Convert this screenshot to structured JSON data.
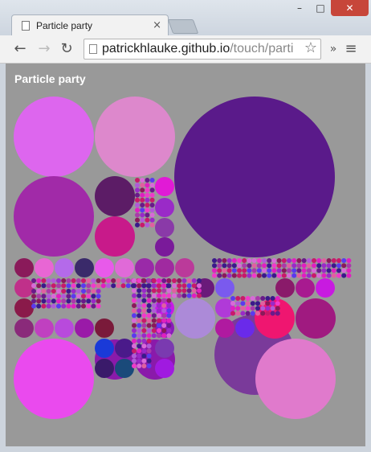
{
  "window": {
    "minimize_glyph": "–",
    "maximize_glyph": "□",
    "close_glyph": "✕"
  },
  "tab": {
    "title": "Particle party",
    "close_glyph": "×"
  },
  "toolbar": {
    "back_glyph": "←",
    "forward_glyph": "→",
    "reload_glyph": "↻",
    "url_host": "patrickhlauke.github.io",
    "url_path": "/touch/parti",
    "bookmark_glyph": "☆",
    "more_glyph": "»",
    "menu_glyph": "≡"
  },
  "page": {
    "heading": "Particle party",
    "background": "#999999"
  }
}
